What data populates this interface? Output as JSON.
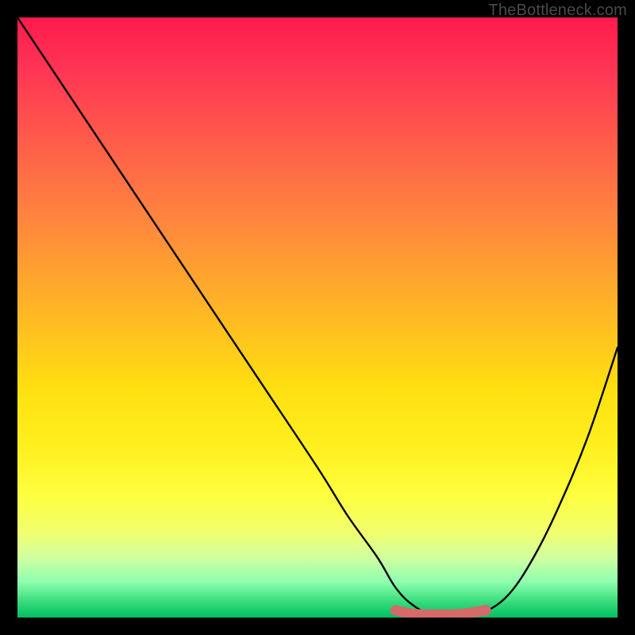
{
  "watermark": "TheBottleneck.com",
  "chart_data": {
    "type": "line",
    "title": "",
    "xlabel": "",
    "ylabel": "",
    "xlim": [
      0,
      100
    ],
    "ylim": [
      0,
      100
    ],
    "series": [
      {
        "name": "bottleneck-curve",
        "x": [
          0,
          10,
          20,
          30,
          40,
          50,
          55,
          60,
          63,
          66,
          70,
          74,
          78,
          82,
          86,
          90,
          95,
          100
        ],
        "values": [
          100,
          85,
          70,
          55,
          40,
          25,
          17,
          10,
          5,
          2,
          0,
          0,
          1,
          4,
          10,
          18,
          30,
          45
        ]
      },
      {
        "name": "highlight-segment",
        "x": [
          63,
          66,
          70,
          74,
          78
        ],
        "values": [
          1.2,
          0.6,
          0.5,
          0.6,
          1.2
        ]
      }
    ],
    "colors": {
      "curve": "#000000",
      "highlight": "#d46a6a",
      "gradient_top": "#ff1a4d",
      "gradient_mid": "#ffe010",
      "gradient_bottom": "#00c060"
    }
  }
}
